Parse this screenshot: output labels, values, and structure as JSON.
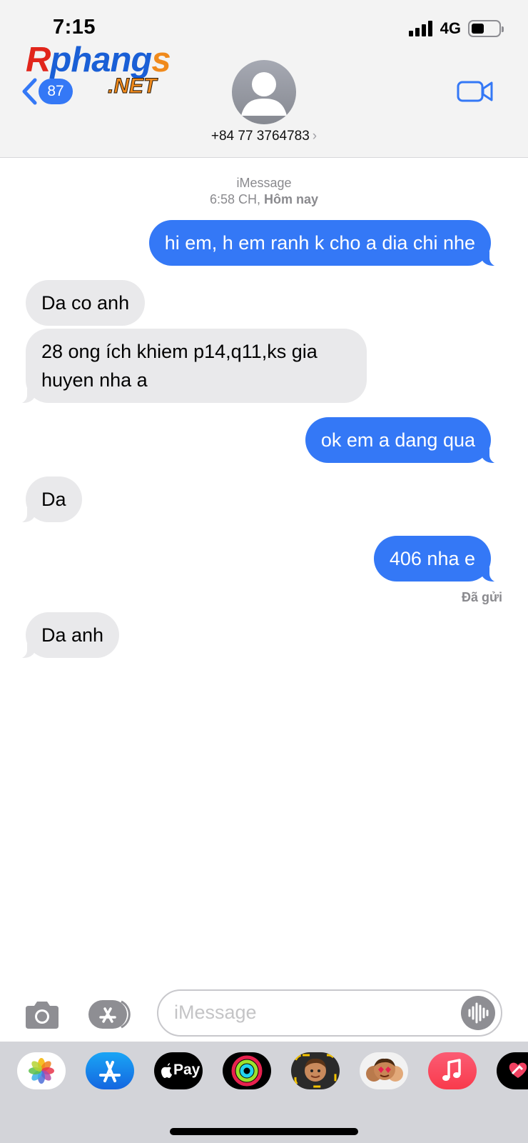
{
  "status_bar": {
    "time": "7:15",
    "network": "4G"
  },
  "watermark": {
    "brand": "Rphangs",
    "domain": ".NET"
  },
  "nav": {
    "unread_count": "87",
    "contact_number": "+84 77 3764783",
    "contact_chevron": "›"
  },
  "thread": {
    "service": "iMessage",
    "timestamp_time": "6:58 CH,",
    "timestamp_day": "Hôm nay",
    "messages": [
      {
        "dir": "out",
        "text": "hi em, h em ranh k cho a dia chi nhe"
      },
      {
        "dir": "in",
        "text": "Da co anh"
      },
      {
        "dir": "in",
        "text": "28 ong ích khiem p14,q11,ks gia huyen nha a"
      },
      {
        "dir": "out",
        "text": "ok em a dang qua"
      },
      {
        "dir": "in",
        "text": "Da"
      },
      {
        "dir": "out",
        "text": "406 nha e"
      },
      {
        "dir": "in",
        "text": "Da anh"
      }
    ],
    "delivered_label": "Đã gửi"
  },
  "composer": {
    "placeholder": "iMessage"
  },
  "app_drawer": {
    "apps": [
      "photos-icon",
      "app-store-icon",
      "apple-pay-icon",
      "activity-icon",
      "memoji-icon",
      "memoji-stickers-icon",
      "music-icon",
      "digital-touch-icon"
    ],
    "apple_pay_label": "Pay"
  },
  "colors": {
    "blue_bubble": "#3478f6",
    "gray_bubble": "#e9e9eb",
    "drawer_bg": "#d3d4d9"
  }
}
